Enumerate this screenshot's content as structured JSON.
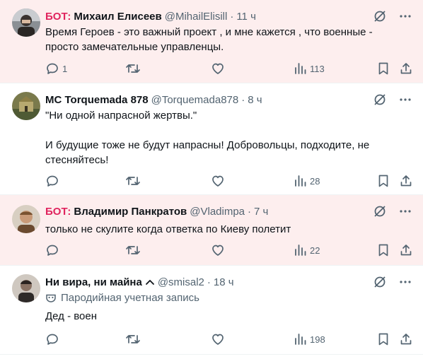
{
  "tweets": [
    {
      "bot": true,
      "bot_label": "БОТ:",
      "name": "Михаил Елисеев",
      "handle": "@MihailElisill",
      "time": "11 ч",
      "text": [
        "Время Героев - это важный проект , и мне кажется , что военные -",
        "просто замечательные управленцы."
      ],
      "replies": "1",
      "views": "113"
    },
    {
      "bot": false,
      "name": "MC Torquemada 878",
      "handle": "@Torquemada878",
      "time": "8 ч",
      "text": [
        "\"Ни одной напрасной жертвы.\"",
        "",
        "И будущие тоже не будут напрасны! Добровольцы, подходите, не",
        "стесняйтесь!"
      ],
      "replies": "",
      "views": "28"
    },
    {
      "bot": true,
      "bot_label": "БОТ:",
      "name": "Владимир Панкратов",
      "handle": "@Vladimpa",
      "time": "7 ч",
      "text": [
        "только не скулите когда ответка по Киеву полетит"
      ],
      "replies": "",
      "views": "22"
    },
    {
      "bot": false,
      "name": "Ни вира, ни майна",
      "handle": "@smisal2",
      "time": "18 ч",
      "parody_label": "Пародийная учетная запись",
      "text": [
        "Дед - воен"
      ],
      "replies": "",
      "views": "198"
    }
  ],
  "icons": {
    "grok": "slashed-circle-icon",
    "more": "more-icon",
    "reply": "reply-icon",
    "retweet": "retweet-icon",
    "like": "like-icon",
    "views": "views-icon",
    "bookmark": "bookmark-icon",
    "share": "share-icon",
    "name_badge": "chevron-up-icon",
    "parody": "mask-icon"
  },
  "colors": {
    "bot_background": "#fdeeee",
    "bot_label": "#e0245e",
    "secondary_text": "#536471",
    "primary_text": "#0f1419"
  }
}
